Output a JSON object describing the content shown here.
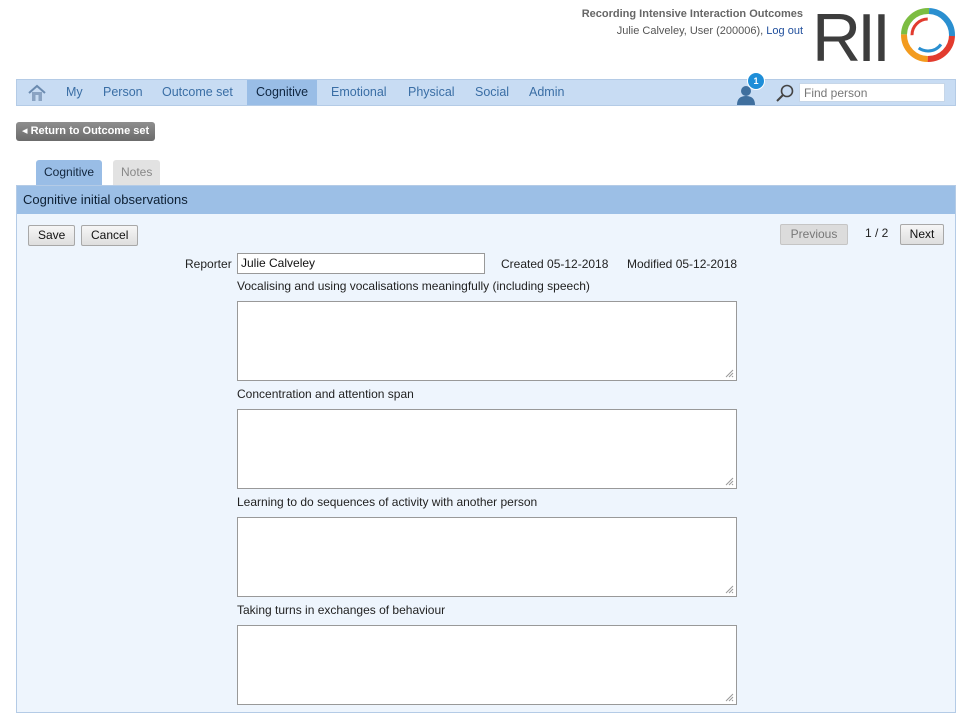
{
  "header": {
    "app_name": "Recording Intensive Interaction Outcomes",
    "user_text": "Julie Calveley, User (200006),",
    "logout_label": "Log out",
    "logo_alt": "RIIO",
    "logo_letters": "RII"
  },
  "nav": {
    "items": [
      {
        "label": "My"
      },
      {
        "label": "Person"
      },
      {
        "label": "Outcome set"
      },
      {
        "label": "Cognitive",
        "active": true
      },
      {
        "label": "Emotional"
      },
      {
        "label": "Physical"
      },
      {
        "label": "Social"
      },
      {
        "label": "Admin"
      }
    ],
    "notification_count": "1",
    "search_placeholder": "Find person"
  },
  "return_button": "◂ Return to Outcome set",
  "tabs": [
    {
      "label": "Cognitive",
      "active": true
    },
    {
      "label": "Notes",
      "active": false
    }
  ],
  "panel": {
    "title": "Cognitive initial observations",
    "save_label": "Save",
    "cancel_label": "Cancel",
    "previous_label": "Previous",
    "pager": "1 / 2",
    "next_label": "Next",
    "reporter_label": "Reporter",
    "reporter_value": "Julie Calveley",
    "created_text": "Created 05-12-2018",
    "modified_text": "Modified 05-12-2018",
    "fields": [
      {
        "label": "Vocalising and using vocalisations meaningfully (including speech)",
        "value": ""
      },
      {
        "label": "Concentration and attention span",
        "value": ""
      },
      {
        "label": "Learning to do sequences of activity with another person",
        "value": ""
      },
      {
        "label": "Taking turns in exchanges of behaviour",
        "value": ""
      }
    ]
  },
  "colors": {
    "nav_bg": "#c8dcf3",
    "nav_active": "#99bde6",
    "panel_bg": "#eef5fd",
    "link": "#1f4e9c",
    "badge": "#1e8ed8"
  }
}
